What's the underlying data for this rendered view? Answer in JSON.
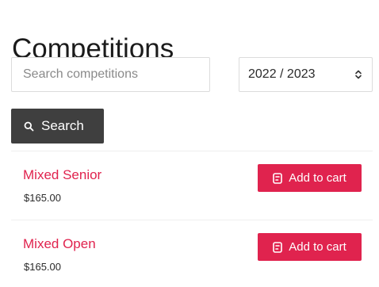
{
  "page": {
    "title": "Competitions"
  },
  "filters": {
    "search_placeholder": "Search competitions",
    "search_value": "",
    "season_selected": "2022 / 2023",
    "search_button_label": "Search"
  },
  "competitions": [
    {
      "name": "Mixed Senior",
      "price": "$165.00",
      "cart_label": "Add to cart"
    },
    {
      "name": "Mixed Open",
      "price": "$165.00",
      "cart_label": "Add to cart"
    }
  ],
  "colors": {
    "accent": "#e0234e",
    "search_button_bg": "#3f3f3f"
  },
  "icons": {
    "search": "search-icon",
    "select": "updown-chevron-icon",
    "cart": "cart-icon"
  }
}
